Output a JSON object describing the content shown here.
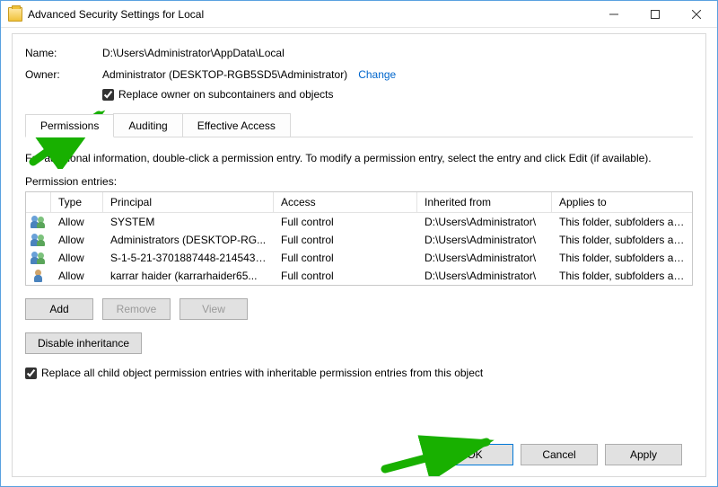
{
  "titlebar": {
    "title": "Advanced Security Settings for Local"
  },
  "header": {
    "name_label": "Name:",
    "name_value": "D:\\Users\\Administrator\\AppData\\Local",
    "owner_label": "Owner:",
    "owner_value": "Administrator (DESKTOP-RGB5SD5\\Administrator)",
    "change_link": "Change",
    "replace_owner_label": "Replace owner on subcontainers and objects"
  },
  "tabs": {
    "permissions": "Permissions",
    "auditing": "Auditing",
    "effective": "Effective Access"
  },
  "info_text": "For additional information, double-click a permission entry. To modify a permission entry, select the entry and click Edit (if available).",
  "entries_label": "Permission entries:",
  "columns": {
    "type": "Type",
    "principal": "Principal",
    "access": "Access",
    "inherited": "Inherited from",
    "applies": "Applies to"
  },
  "rows": [
    {
      "icon": "group",
      "type": "Allow",
      "principal": "SYSTEM",
      "access": "Full control",
      "inherited": "D:\\Users\\Administrator\\",
      "applies": "This folder, subfolders and files"
    },
    {
      "icon": "group",
      "type": "Allow",
      "principal": "Administrators (DESKTOP-RG...",
      "access": "Full control",
      "inherited": "D:\\Users\\Administrator\\",
      "applies": "This folder, subfolders and files"
    },
    {
      "icon": "group",
      "type": "Allow",
      "principal": "S-1-5-21-3701887448-2145437...",
      "access": "Full control",
      "inherited": "D:\\Users\\Administrator\\",
      "applies": "This folder, subfolders and files"
    },
    {
      "icon": "single",
      "type": "Allow",
      "principal": "karrar haider (karrarhaider65...",
      "access": "Full control",
      "inherited": "D:\\Users\\Administrator\\",
      "applies": "This folder, subfolders and files"
    }
  ],
  "buttons": {
    "add": "Add",
    "remove": "Remove",
    "view": "View",
    "disable_inh": "Disable inheritance",
    "ok": "OK",
    "cancel": "Cancel",
    "apply": "Apply"
  },
  "bottom_checkbox": "Replace all child object permission entries with inheritable permission entries from this object"
}
